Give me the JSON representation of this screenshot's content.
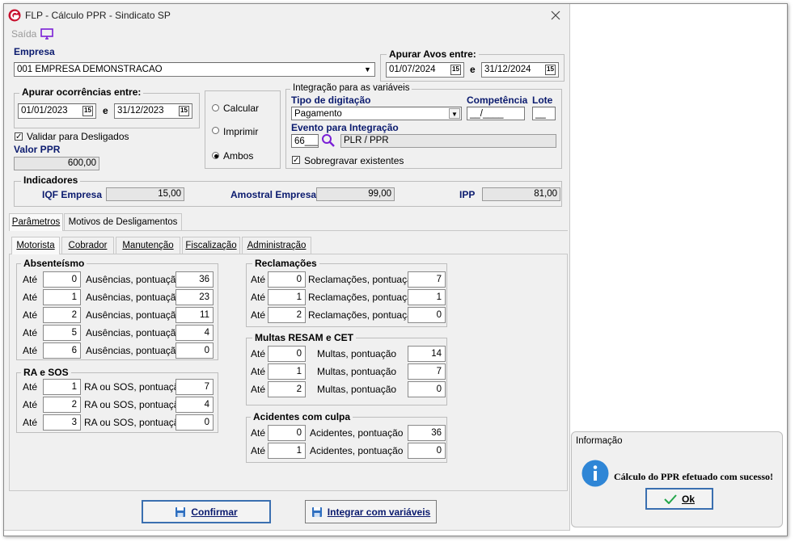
{
  "window": {
    "title": "FLP - Cálculo PPR - Sindicato SP",
    "saida_label": "Saída"
  },
  "empresa": {
    "label": "Empresa",
    "value": "001 EMPRESA DEMONSTRACAO"
  },
  "avos": {
    "label": "Apurar Avos entre:",
    "start": "01/07/2024",
    "conj": "e",
    "end": "31/12/2024"
  },
  "ocorrencias": {
    "label": "Apurar ocorrências entre:",
    "start": "01/01/2023",
    "conj": "e",
    "end": "31/12/2023"
  },
  "calendar_glyph": "15",
  "validar_label": "Validar para Desligados",
  "valor_ppr": {
    "label": "Valor PPR",
    "value": "600,00"
  },
  "modo": {
    "options": [
      "Calcular",
      "Imprimir",
      "Ambos"
    ],
    "selected": "Ambos"
  },
  "integracao": {
    "title": "Integração para as variáveis",
    "tipo_label": "Tipo de digitação",
    "tipo_value": "Pagamento",
    "competencia_label": "Competência",
    "competencia_value": "__/____",
    "lote_label": "Lote",
    "lote_value": "__",
    "evento_label": "Evento para Integração",
    "evento_code": "66___",
    "evento_desc": "PLR / PPR",
    "sobregravar_label": "Sobregravar existentes"
  },
  "indicadores": {
    "title": "Indicadores",
    "iqf_label": "IQF Empresa",
    "iqf_value": "15,00",
    "amostral_label": "Amostral Empresa",
    "amostral_value": "99,00",
    "ipp_label": "IPP",
    "ipp_value": "81,00"
  },
  "main_tabs": [
    "Parâmetros",
    "Motivos de Desligamentos"
  ],
  "sub_tabs": [
    "Motorista",
    "Cobrador",
    "Manutenção",
    "Fiscalização",
    "Administração"
  ],
  "ate_label": "Até",
  "absenteismo": {
    "title": "Absenteísmo",
    "row_label": "Ausências, pontuação",
    "rows": [
      {
        "ate": "0",
        "pts": "36"
      },
      {
        "ate": "1",
        "pts": "23"
      },
      {
        "ate": "2",
        "pts": "11"
      },
      {
        "ate": "5",
        "pts": "4"
      },
      {
        "ate": "6",
        "pts": "0"
      }
    ]
  },
  "ra_sos": {
    "title": "RA e SOS",
    "row_label": "RA ou SOS, pontuação",
    "rows": [
      {
        "ate": "1",
        "pts": "7"
      },
      {
        "ate": "2",
        "pts": "4"
      },
      {
        "ate": "3",
        "pts": "0"
      }
    ]
  },
  "reclamacoes": {
    "title": "Reclamações",
    "row_label": "Reclamações, pontuação",
    "rows": [
      {
        "ate": "0",
        "pts": "7"
      },
      {
        "ate": "1",
        "pts": "1"
      },
      {
        "ate": "2",
        "pts": "0"
      }
    ]
  },
  "multas": {
    "title": "Multas RESAM e CET",
    "row_label": "Multas, pontuação",
    "rows": [
      {
        "ate": "0",
        "pts": "14"
      },
      {
        "ate": "1",
        "pts": "7"
      },
      {
        "ate": "2",
        "pts": "0"
      }
    ]
  },
  "acidentes": {
    "title": "Acidentes com culpa",
    "row_label": "Acidentes, pontuação",
    "rows": [
      {
        "ate": "0",
        "pts": "36"
      },
      {
        "ate": "1",
        "pts": "0"
      }
    ]
  },
  "buttons": {
    "confirmar": "Confirmar",
    "integrar": "Integrar com variáveis"
  },
  "info": {
    "title": "Informação",
    "message": "Cálculo do PPR efetuado com sucesso!",
    "ok_label": "Ok"
  },
  "colors": {
    "accent_red": "#c8102e",
    "info_blue": "#2f86d6",
    "icon_purple": "#7a1fd6"
  }
}
